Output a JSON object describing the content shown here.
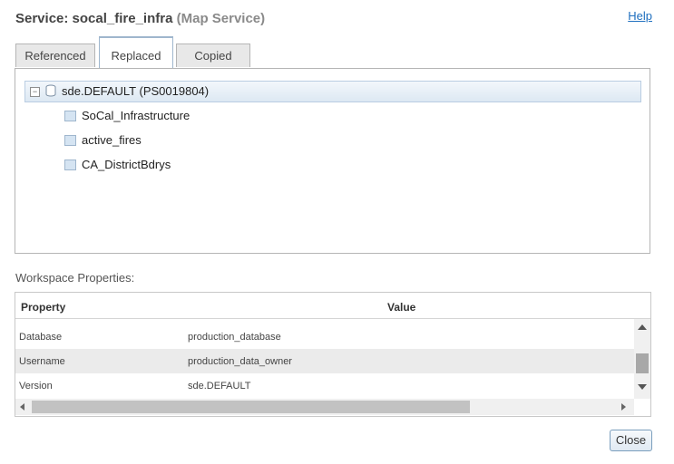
{
  "header": {
    "title_prefix": "Service: socal_fire_infra",
    "title_type": "(Map Service)",
    "help_label": "Help"
  },
  "tabs": [
    {
      "label": "Referenced",
      "active": false
    },
    {
      "label": "Replaced",
      "active": true
    },
    {
      "label": "Copied",
      "active": false
    }
  ],
  "tree": {
    "root_toggle": "−",
    "root_icon": "database-icon",
    "root_label": "sde.DEFAULT (PS0019804)",
    "items": [
      {
        "label": "SoCal_Infrastructure",
        "icon": "layer-icon"
      },
      {
        "label": "active_fires",
        "icon": "layer-icon"
      },
      {
        "label": "CA_DistrictBdrys",
        "icon": "layer-icon"
      }
    ]
  },
  "workspace": {
    "section_label": "Workspace Properties:",
    "columns": [
      "Property",
      "Value"
    ],
    "rows": [
      {
        "property": "Database",
        "value": "production_database"
      },
      {
        "property": "Username",
        "value": "production_data_owner"
      },
      {
        "property": "Version",
        "value": "sde.DEFAULT"
      }
    ]
  },
  "footer": {
    "close_label": "Close"
  },
  "colors": {
    "accent": "#9fb6cd",
    "link": "#1f6fbf"
  }
}
